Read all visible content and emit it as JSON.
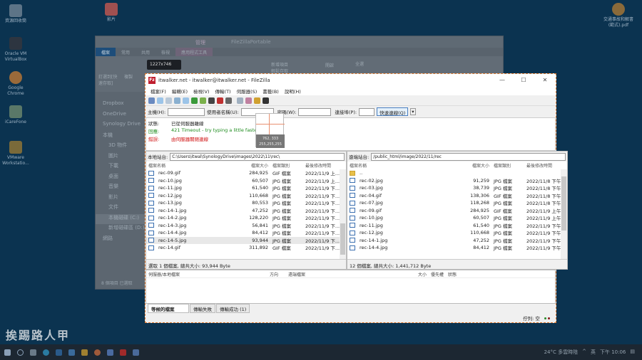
{
  "desktop": {
    "icons_left": [
      "資源回收筒",
      "Oracle VM VirtualBox",
      "Google Chrome",
      "iCareFone",
      "VMware Workstatio..."
    ],
    "icons_top": [
      "影片"
    ],
    "icons_right": [
      "交通事故和解書(範式).pdf"
    ],
    "watermark": "挨踢路人甲"
  },
  "explorer": {
    "title": "FileZillaPortable",
    "manage_tab": "管理",
    "ribbon_tabs": [
      "檔案",
      "常用",
      "共用",
      "檢視",
      "應用程式工具"
    ],
    "ribbon_items": [
      "釘選到[快速存取]",
      "複製",
      "新增項目",
      "輕鬆存取",
      "開啟",
      "全選"
    ],
    "nav": [
      "Dropbox",
      "OneDrive",
      "Synology Drive",
      "本機",
      "3D 物件",
      "圖片",
      "下載",
      "桌面",
      "音樂",
      "影片",
      "文件",
      "本機磁碟 (C:)",
      "新增磁碟區 (D:)",
      "網路"
    ],
    "footer": "8 個項目   已選取",
    "size_tooltip": "1227x746"
  },
  "filezilla": {
    "title": "itwalker.net - itwalker@itwalker.net - FileZilla",
    "menu": [
      "檔案(F)",
      "編輯(E)",
      "檢視(V)",
      "傳輸(T)",
      "伺服器(S)",
      "書籤(B)",
      "說明(H)"
    ],
    "quickconnect": {
      "host_label": "主機(H):",
      "host_value": "",
      "user_label": "使用者名稱(U):",
      "user_value": "",
      "pass_label": "密碼(W):",
      "pass_value": "",
      "port_label": "連接埠(P):",
      "port_value": "",
      "button": "快速連線(Q)"
    },
    "log": [
      {
        "key": "狀態:",
        "text": "已從伺服器離線",
        "color": "#222222"
      },
      {
        "key": "回應:",
        "text": "421 Timeout - try typing a little faster next time",
        "color": "#1a8a1a"
      },
      {
        "key": "錯誤:",
        "text": "由伺服器關閉連線",
        "color": "#d01010"
      }
    ],
    "local": {
      "label": "本地站台:",
      "path": "C:\\Users\\itwal\\SynologyDrive\\images\\2022\\11\\rec\\",
      "headers": [
        "檔案名稱",
        "檔案大小",
        "檔案類別",
        "最後修改時間"
      ],
      "files": [
        {
          "name": "rec-09.gif",
          "size": "284,925",
          "type": "GIF 檔案",
          "date": "2022/11/9 上..."
        },
        {
          "name": "rec-10.jpg",
          "size": "60,507",
          "type": "JPG 檔案",
          "date": "2022/11/9 上..."
        },
        {
          "name": "rec-11.jpg",
          "size": "61,540",
          "type": "JPG 檔案",
          "date": "2022/11/9 下..."
        },
        {
          "name": "rec-12.jpg",
          "size": "110,668",
          "type": "JPG 檔案",
          "date": "2022/11/9 下..."
        },
        {
          "name": "rec-13.jpg",
          "size": "80,553",
          "type": "JPG 檔案",
          "date": "2022/11/9 下..."
        },
        {
          "name": "rec-14-1.jpg",
          "size": "47,252",
          "type": "JPG 檔案",
          "date": "2022/11/9 下..."
        },
        {
          "name": "rec-14-2.jpg",
          "size": "128,220",
          "type": "JPG 檔案",
          "date": "2022/11/9 下..."
        },
        {
          "name": "rec-14-3.jpg",
          "size": "56,841",
          "type": "JPG 檔案",
          "date": "2022/11/9 下..."
        },
        {
          "name": "rec-14-4.jpg",
          "size": "84,412",
          "type": "JPG 檔案",
          "date": "2022/11/9 下..."
        },
        {
          "name": "rec-14-5.jpg",
          "size": "93,944",
          "type": "JPG 檔案",
          "date": "2022/11/9 下...",
          "selected": true
        },
        {
          "name": "rec-14.gif",
          "size": "311,892",
          "type": "GIF 檔案",
          "date": "2022/11/9 下..."
        }
      ],
      "status": "選取 1 個檔案, 總共大小: 93,944 Byte"
    },
    "remote": {
      "label": "遠端站台:",
      "path": "/public_html/image/2022/11/rec",
      "headers": [
        "檔案名稱",
        "檔案大小",
        "檔案類別",
        "最後修改時間"
      ],
      "files": [
        {
          "name": "..",
          "size": "",
          "type": "",
          "date": "",
          "dir": true
        },
        {
          "name": "rec-02.jpg",
          "size": "91,259",
          "type": "JPG 檔案",
          "date": "2022/11/8 下午"
        },
        {
          "name": "rec-03.jpg",
          "size": "38,739",
          "type": "JPG 檔案",
          "date": "2022/11/8 下午"
        },
        {
          "name": "rec-04.gif",
          "size": "138,306",
          "type": "GIF 檔案",
          "date": "2022/11/8 下午"
        },
        {
          "name": "rec-07.jpg",
          "size": "118,268",
          "type": "JPG 檔案",
          "date": "2022/11/8 下午"
        },
        {
          "name": "rec-09.gif",
          "size": "284,925",
          "type": "GIF 檔案",
          "date": "2022/11/9 上午"
        },
        {
          "name": "rec-10.jpg",
          "size": "60,507",
          "type": "JPG 檔案",
          "date": "2022/11/9 上午"
        },
        {
          "name": "rec-11.jpg",
          "size": "61,540",
          "type": "JPG 檔案",
          "date": "2022/11/9 下午"
        },
        {
          "name": "rec-12.jpg",
          "size": "110,668",
          "type": "JPG 檔案",
          "date": "2022/11/9 下午"
        },
        {
          "name": "rec-14-1.jpg",
          "size": "47,252",
          "type": "JPG 檔案",
          "date": "2022/11/9 下午"
        },
        {
          "name": "rec-14-4.jpg",
          "size": "84,412",
          "type": "JPG 檔案",
          "date": "2022/11/9 下午"
        }
      ],
      "status": "12 個檔案, 總共大小: 1,441,712 Byte"
    },
    "queue_headers": [
      "伺服器/本地檔案",
      "方向",
      "遠端檔案",
      "大小",
      "優先權",
      "狀態"
    ],
    "queue_tabs": [
      "等候的檔案",
      "傳輸失敗",
      "傳輸成功 (1)"
    ],
    "status_queue": "佇列: 空"
  },
  "cursor_readout": {
    "coords": "762, 333",
    "rgb": "255,255,255"
  },
  "taskbar": {
    "weather": "24°C 多雲時陰",
    "lang": "英",
    "time": "下午 10:06"
  },
  "colors": {
    "accent": "#e07a2f",
    "filezilla_red": "#bf1e2e",
    "desktop": "#0b3350"
  }
}
